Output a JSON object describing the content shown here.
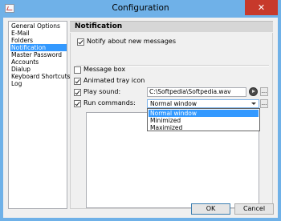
{
  "window": {
    "title": "Configuration",
    "close_glyph": "✕"
  },
  "nav": {
    "items": [
      {
        "label": "General Options"
      },
      {
        "label": "E-Mail"
      },
      {
        "label": "Folders"
      },
      {
        "label": "Notification",
        "selected": true
      },
      {
        "label": "Master Password"
      },
      {
        "label": "Accounts"
      },
      {
        "label": "Dialup"
      },
      {
        "label": "Keyboard Shortcuts"
      },
      {
        "label": "Log"
      }
    ]
  },
  "panel": {
    "header": "Notification",
    "notify_label": "Notify about new messages",
    "notify_checked": true,
    "message_box_label": "Message box",
    "message_box_checked": false,
    "tray_label": "Animated tray icon",
    "tray_checked": true,
    "play_sound_label": "Play sound:",
    "play_sound_checked": true,
    "sound_path": "C:\\Softpedia\\Softpedia.wav",
    "run_commands_label": "Run commands:",
    "run_commands_checked": true,
    "window_mode_value": "Normal window",
    "window_mode_options": [
      "Normal window",
      "Minimized",
      "Maximized"
    ],
    "ellipsis": "..."
  },
  "footer": {
    "ok_label": "OK",
    "cancel_label": "Cancel"
  },
  "colors": {
    "titlebar": "#6fb1e8",
    "selection": "#3399ff",
    "close": "#c7392b"
  },
  "icons": [
    "app-icon",
    "close-icon",
    "play-icon",
    "dropdown-arrow-icon"
  ]
}
